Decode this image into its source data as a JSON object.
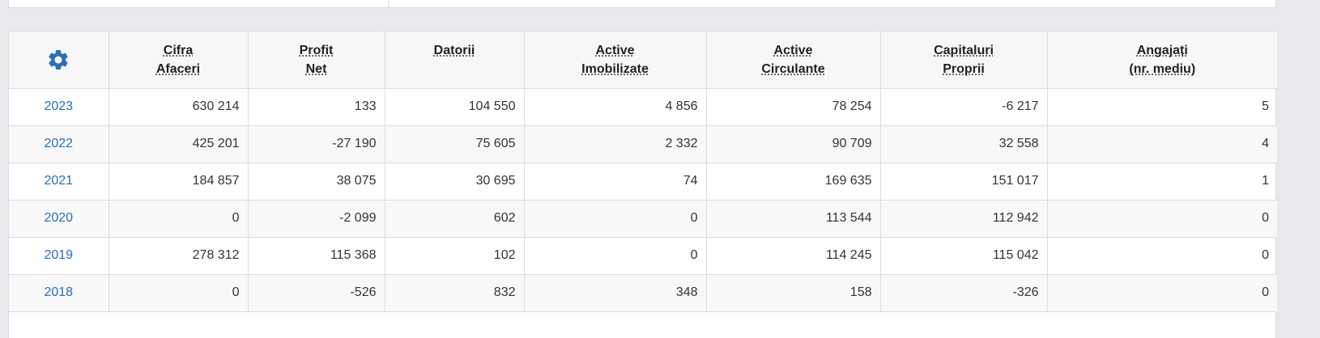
{
  "table": {
    "columns": [
      {
        "line1": "Cifra",
        "line2": "Afaceri"
      },
      {
        "line1": "Profit",
        "line2": "Net"
      },
      {
        "line1": "Datorii",
        "line2": ""
      },
      {
        "line1": "Active",
        "line2": "Imobilizate"
      },
      {
        "line1": "Active",
        "line2": "Circulante"
      },
      {
        "line1": "Capitaluri",
        "line2": "Proprii"
      },
      {
        "line1": "Angajați",
        "line2": "(nr. mediu)"
      }
    ],
    "rows": [
      {
        "year": "2023",
        "cells": [
          "630 214",
          "133",
          "104 550",
          "4 856",
          "78 254",
          "-6 217",
          "5"
        ]
      },
      {
        "year": "2022",
        "cells": [
          "425 201",
          "-27 190",
          "75 605",
          "2 332",
          "90 709",
          "32 558",
          "4"
        ]
      },
      {
        "year": "2021",
        "cells": [
          "184 857",
          "38 075",
          "30 695",
          "74",
          "169 635",
          "151 017",
          "1"
        ]
      },
      {
        "year": "2020",
        "cells": [
          "0",
          "-2 099",
          "602",
          "0",
          "113 544",
          "112 942",
          "0"
        ]
      },
      {
        "year": "2019",
        "cells": [
          "278 312",
          "115 368",
          "102",
          "0",
          "114 245",
          "115 042",
          "0"
        ]
      },
      {
        "year": "2018",
        "cells": [
          "0",
          "-526",
          "832",
          "348",
          "158",
          "-326",
          "0"
        ]
      }
    ]
  },
  "settings_icon": "gear-icon",
  "colors": {
    "accent": "#2a6fb8",
    "header_bg": "#f7f7f7",
    "border": "#dcdde0",
    "page_bg": "#e8e9ec"
  }
}
